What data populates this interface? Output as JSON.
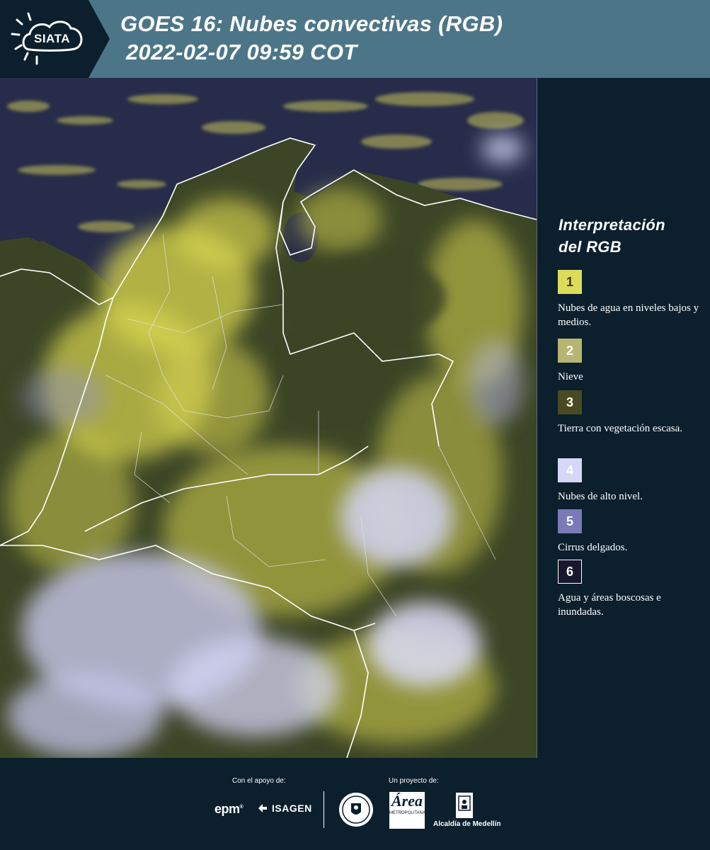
{
  "header": {
    "logo_text": "SIATA",
    "title_line1": "GOES 16: Nubes convectivas (RGB)",
    "title_line2": "2022-02-07 09:59 COT"
  },
  "map": {
    "colors": {
      "ocean": "#272c4a",
      "land_dark": "#3c4526",
      "low_cloud_yellow": "#d8d650",
      "high_cloud_lavender": "#d4d4f4",
      "border_line": "#ffffff"
    }
  },
  "legend": {
    "title_line1": "Interpretación",
    "title_line2": "del RGB",
    "items": [
      {
        "number": "1",
        "label": "Nubes de agua en niveles bajos y medios.",
        "color": "#dcdc5a",
        "text_color": "#3a3a1a"
      },
      {
        "number": "2",
        "label": "Nieve",
        "color": "#b8b472",
        "text_color": "#ffffff"
      },
      {
        "number": "3",
        "label": "Tierra con vegetación escasa.",
        "color": "#4a4a22",
        "text_color": "#ffffff"
      },
      {
        "number": "4",
        "label": "Nubes de alto nivel.",
        "color": "#d6d6f6",
        "text_color": "#ffffff"
      },
      {
        "number": "5",
        "label": "Cirrus delgados.",
        "color": "#7a7ab8",
        "text_color": "#ffffff"
      },
      {
        "number": "6",
        "label": "Agua y áreas boscosas e inundadas.",
        "color": "#17182e",
        "text_color": "#ffffff"
      }
    ]
  },
  "footer": {
    "support_caption": "Con el apoyo de:",
    "project_caption": "Un proyecto de:",
    "epm_logo_text": "epm",
    "isagen_logo_text": "ISAGEN",
    "area_logo_text": "Área",
    "area_logo_subtext": "METROPOLITANA",
    "alcaldia_text": "Alcaldía de Medellín"
  }
}
